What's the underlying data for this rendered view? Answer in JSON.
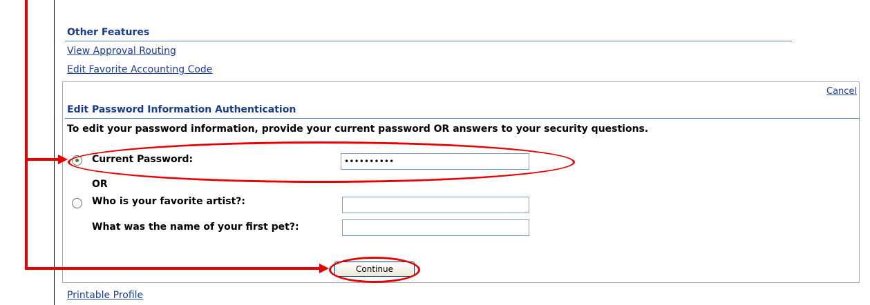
{
  "other_features": {
    "title": "Other Features",
    "links": [
      "View Approval Routing",
      "Edit Favorite Accounting Code"
    ]
  },
  "panel": {
    "cancel_label": "Cancel",
    "title": "Edit Password Information Authentication",
    "instructions": "To edit your password information, provide your current password OR answers to your security questions.",
    "current_password": {
      "label": "Current Password:",
      "value": "••••••••••",
      "selected": true
    },
    "or_label": "OR",
    "security_questions": [
      {
        "label": "Who is your favorite artist?:",
        "value": ""
      },
      {
        "label": "What was the name of your first pet?:",
        "value": ""
      }
    ],
    "continue_label": "Continue"
  },
  "footer": {
    "printable_profile_label": "Printable Profile"
  },
  "annotation": {
    "color": "#e60000"
  }
}
